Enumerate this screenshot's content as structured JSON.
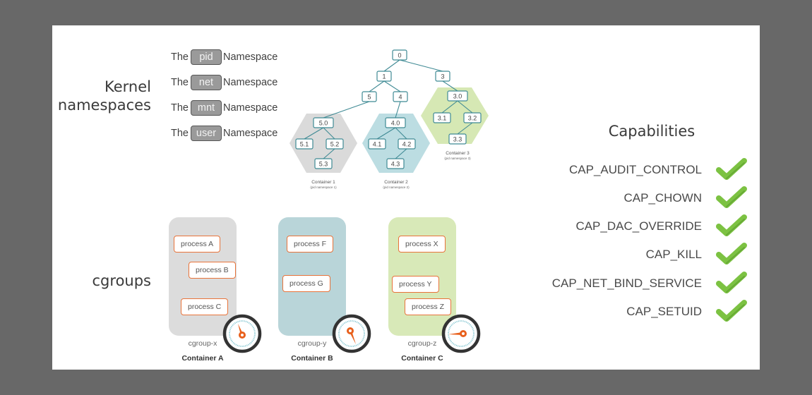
{
  "sections": {
    "namespaces_title_line1": "Kernel",
    "namespaces_title_line2": "namespaces",
    "cgroups_title": "cgroups",
    "capabilities_title": "Capabilities"
  },
  "namespaces": [
    {
      "prefix": "The",
      "name": "pid",
      "suffix": "Namespace"
    },
    {
      "prefix": "The",
      "name": "net",
      "suffix": "Namespace"
    },
    {
      "prefix": "The",
      "name": "mnt",
      "suffix": "Namespace"
    },
    {
      "prefix": "The",
      "name": "user",
      "suffix": "Namespace"
    }
  ],
  "pid_tree": {
    "nodes": {
      "n0": "0",
      "n1": "1",
      "n3": "3",
      "n5": "5",
      "n4": "4",
      "n50": "5.0",
      "n51": "5.1",
      "n52": "5.2",
      "n53": "5.3",
      "n40": "4.0",
      "n41": "4.1",
      "n42": "4.2",
      "n43": "4.3",
      "n30": "3.0",
      "n31": "3.1",
      "n32": "3.2",
      "n33": "3.3"
    },
    "containers": [
      {
        "label": "Container 1",
        "sublabel": "(pid namespace 1)",
        "color": "#dadada"
      },
      {
        "label": "Container 2",
        "sublabel": "(pid namespace 2)",
        "color": "#bcdde2"
      },
      {
        "label": "Container 3",
        "sublabel": "(pid namespace 3)",
        "color": "#d6e8b4"
      }
    ],
    "line_color": "#3f8a94"
  },
  "cgroups": [
    {
      "group": "cgroup-x",
      "container": "Container A",
      "color": "#dcdcdc",
      "processes": [
        "process A",
        "process B",
        "process C"
      ]
    },
    {
      "group": "cgroup-y",
      "container": "Container B",
      "color": "#b9d5d9",
      "processes": [
        "process F",
        "process G"
      ]
    },
    {
      "group": "cgroup-z",
      "container": "Container C",
      "color": "#d8e9b8",
      "processes": [
        "process X",
        "process Y",
        "process Z"
      ]
    }
  ],
  "capabilities": [
    {
      "name": "CAP_AUDIT_CONTROL",
      "enabled": true
    },
    {
      "name": "CAP_CHOWN",
      "enabled": true
    },
    {
      "name": "CAP_DAC_OVERRIDE",
      "enabled": true
    },
    {
      "name": "CAP_KILL",
      "enabled": true
    },
    {
      "name": "CAP_NET_BIND_SERVICE",
      "enabled": true
    },
    {
      "name": "CAP_SETUID",
      "enabled": true
    }
  ],
  "colors": {
    "process_border": "#e8733a",
    "gauge_ring": "#333333",
    "gauge_needle": "#e8601c",
    "check_green": "#7cc242"
  }
}
